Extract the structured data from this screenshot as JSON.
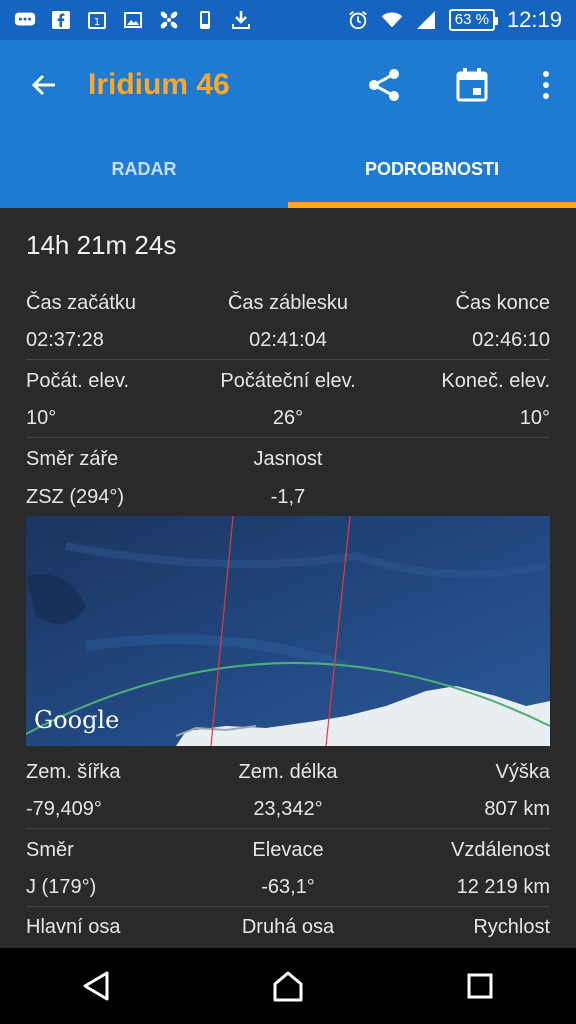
{
  "statusbar": {
    "battery": "63 %",
    "time": "12:19"
  },
  "appbar": {
    "title": "Iridium 46"
  },
  "tabs": [
    {
      "label": "RADAR"
    },
    {
      "label": "PODROBNOSTI"
    }
  ],
  "countdown": "14h 21m 24s",
  "rows": {
    "times": {
      "labels": [
        "Čas začátku",
        "Čas záblesku",
        "Čas konce"
      ],
      "values": [
        "02:37:28",
        "02:41:04",
        "02:46:10"
      ]
    },
    "elev": {
      "labels": [
        "Počát. elev.",
        "Počáteční elev.",
        "Koneč. elev."
      ],
      "values": [
        "10°",
        "26°",
        "10°"
      ]
    },
    "dir": {
      "labels": [
        "Směr záře",
        "Jasnost",
        ""
      ],
      "values": [
        "ZSZ (294°)",
        "-1,7",
        ""
      ]
    },
    "pos": {
      "labels": [
        "Zem. šířka",
        "Zem. délka",
        "Výška"
      ],
      "values": [
        "-79,409°",
        "23,342°",
        "807 km"
      ]
    },
    "heading": {
      "labels": [
        "Směr",
        "Elevace",
        "Vzdálenost"
      ],
      "values": [
        "J (179°)",
        "-63,1°",
        "12 219 km"
      ]
    },
    "axes": {
      "labels": [
        "Hlavní osa",
        "Druhá osa",
        "Rychlost"
      ]
    }
  },
  "map": {
    "attribution": "Google"
  },
  "colors": {
    "primary": "#1e7bd1",
    "accent": "#ffa726",
    "status": "#1565c0",
    "content_bg": "#2a2a2a"
  }
}
